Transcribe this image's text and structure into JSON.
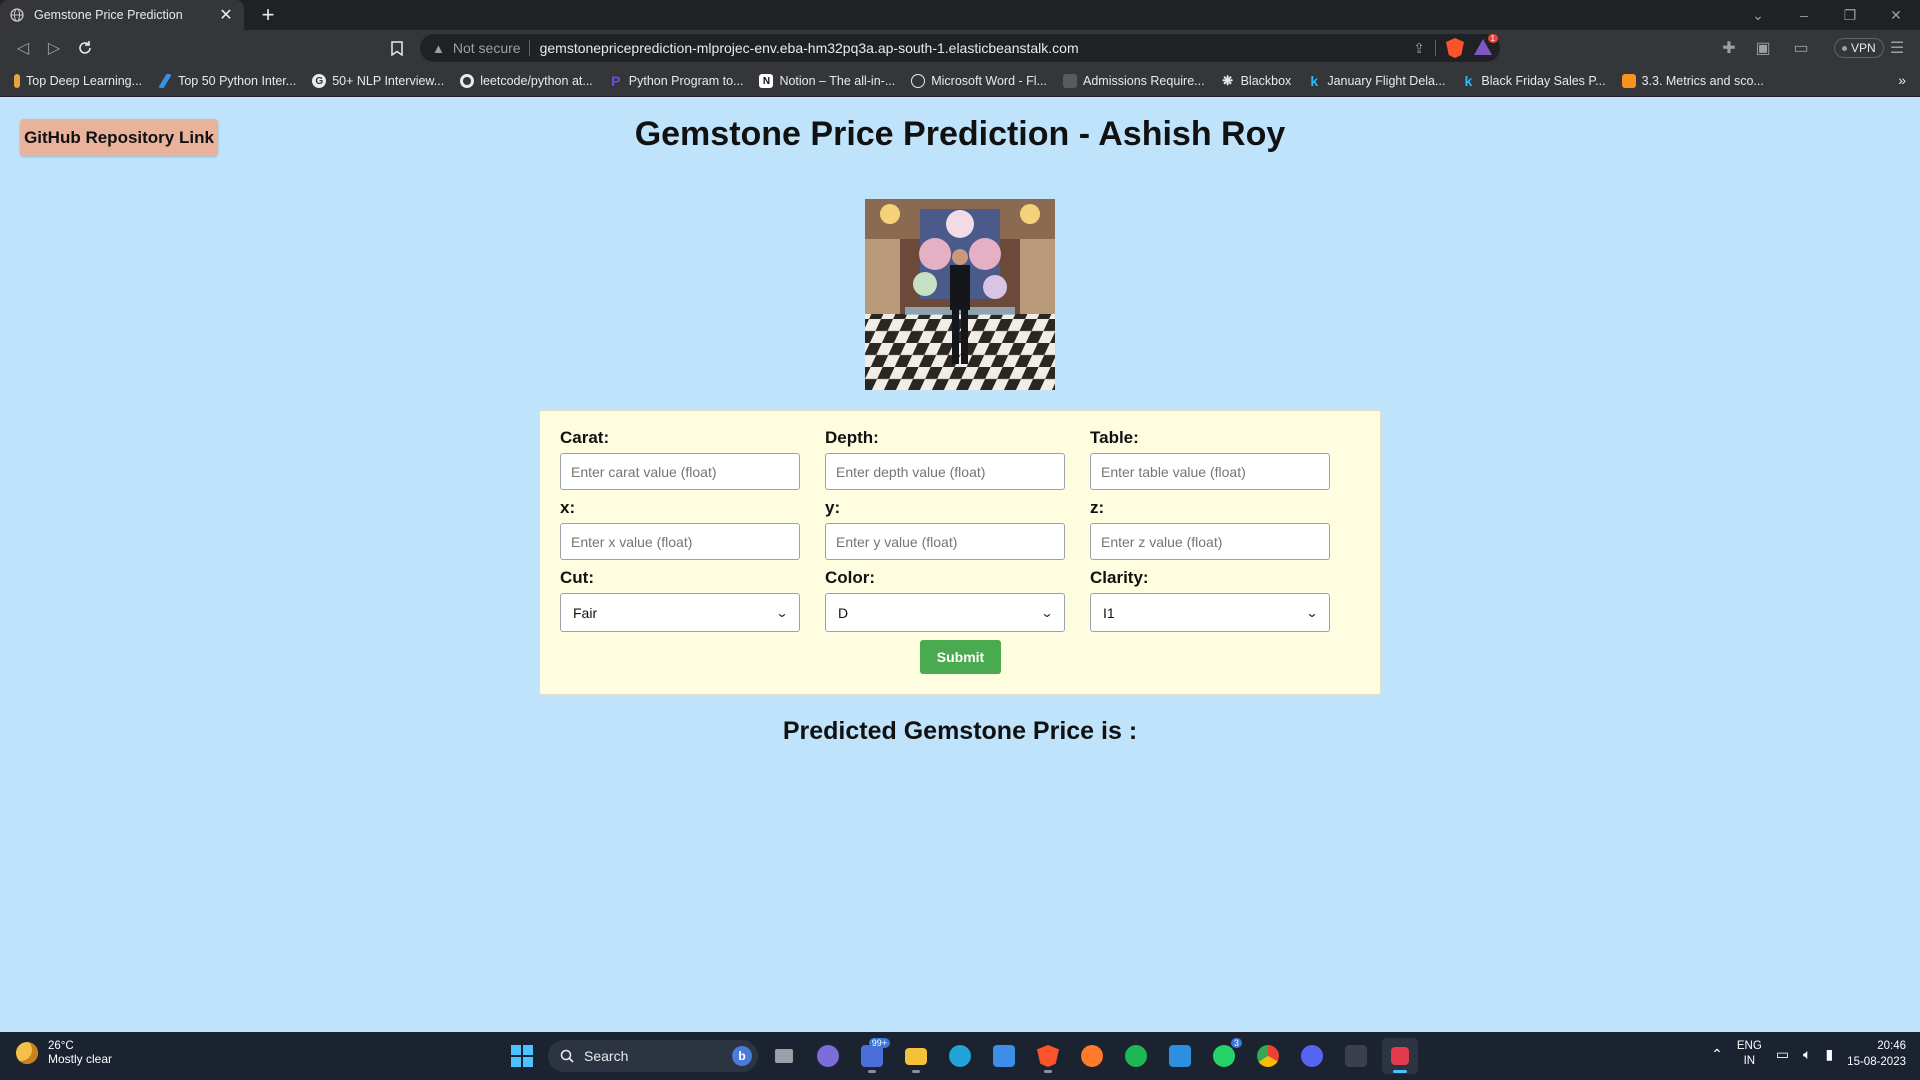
{
  "browser": {
    "tab_title": "Gemstone Price Prediction",
    "url": "gemstonepriceprediction-mlprojec-env.eba-hm32pq3a.ap-south-1.elasticbeanstalk.com",
    "security_label": "Not secure",
    "vpn_label": "VPN",
    "rewards_badge": "1",
    "bookmarks": [
      {
        "label": "Top Deep Learning...",
        "icon": "bookmark-favicon",
        "color": "#e8a33a"
      },
      {
        "label": "Top 50 Python Inter...",
        "icon": "bookmark-favicon",
        "color": "#3a8ee8"
      },
      {
        "label": "50+ NLP Interview...",
        "icon": "bookmark-favicon",
        "color": "#e8eaed"
      },
      {
        "label": "leetcode/python at...",
        "icon": "github-icon",
        "color": "#e8eaed"
      },
      {
        "label": "Python Program to...",
        "icon": "bookmark-favicon",
        "color": "#6a4de8"
      },
      {
        "label": "Notion – The all-in-...",
        "icon": "notion-icon",
        "color": "#ffffff"
      },
      {
        "label": "Microsoft Word - Fl...",
        "icon": "globe-icon",
        "color": "#e8eaed"
      },
      {
        "label": "Admissions Require...",
        "icon": "bookmark-favicon",
        "color": "#555a63"
      },
      {
        "label": "Blackbox",
        "icon": "bookmark-favicon",
        "color": "#e8eaed"
      },
      {
        "label": "January Flight Dela...",
        "icon": "kaggle-icon",
        "color": "#20beff"
      },
      {
        "label": "Black Friday Sales P...",
        "icon": "kaggle-icon",
        "color": "#20beff"
      },
      {
        "label": "3.3. Metrics and sco...",
        "icon": "bookmark-favicon",
        "color": "#f7931e"
      }
    ]
  },
  "page": {
    "github_button": "GitHub Repository Link",
    "title": "Gemstone Price Prediction - Ashish Roy",
    "form": {
      "fields": [
        {
          "label": "Carat:",
          "placeholder": "Enter carat value (float)"
        },
        {
          "label": "Depth:",
          "placeholder": "Enter depth value (float)"
        },
        {
          "label": "Table:",
          "placeholder": "Enter table value (float)"
        },
        {
          "label": "x:",
          "placeholder": "Enter x value (float)"
        },
        {
          "label": "y:",
          "placeholder": "Enter y value (float)"
        },
        {
          "label": "z:",
          "placeholder": "Enter z value (float)"
        }
      ],
      "selects": [
        {
          "label": "Cut:",
          "value": "Fair"
        },
        {
          "label": "Color:",
          "value": "D"
        },
        {
          "label": "Clarity:",
          "value": "I1"
        }
      ],
      "submit_label": "Submit"
    },
    "result_label": "Predicted Gemstone Price is :"
  },
  "taskbar": {
    "temperature": "26°C",
    "condition": "Mostly clear",
    "search_label": "Search",
    "teams_badge": "99+",
    "whatsapp_badge": "3",
    "lang_top": "ENG",
    "lang_bottom": "IN",
    "time": "20:46",
    "date": "15-08-2023"
  }
}
